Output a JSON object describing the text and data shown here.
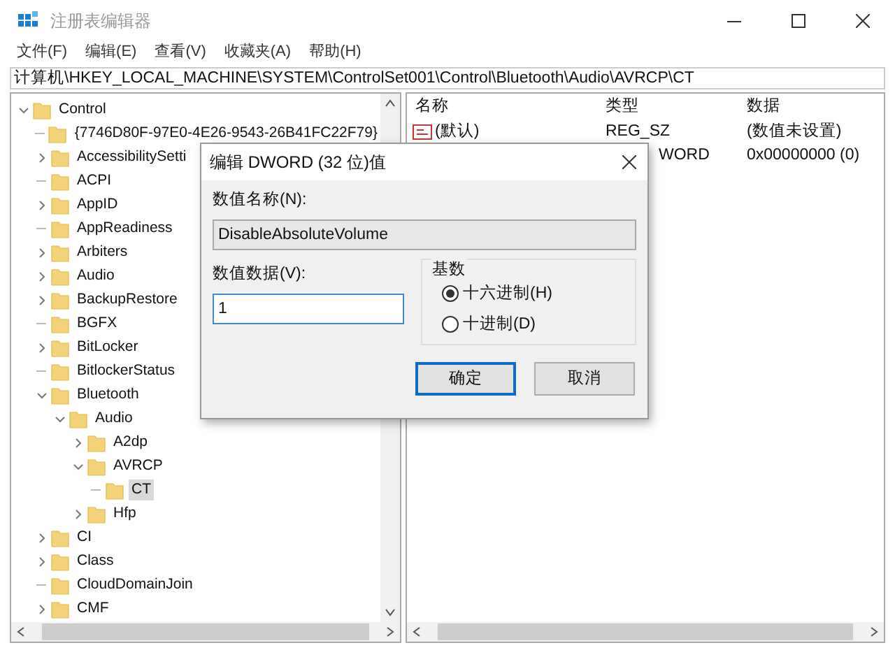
{
  "window": {
    "title": "注册表编辑器"
  },
  "menu": [
    "文件(F)",
    "编辑(E)",
    "查看(V)",
    "收藏夹(A)",
    "帮助(H)"
  ],
  "address": "计算机\\HKEY_LOCAL_MACHINE\\SYSTEM\\ControlSet001\\Control\\Bluetooth\\Audio\\AVRCP\\CT",
  "tree": [
    {
      "label": "Control",
      "expandable": true,
      "expanded": true,
      "selected": false,
      "children": [
        {
          "label": "{7746D80F-97E0-4E26-9543-26B41FC22F79}",
          "expandable": false,
          "selected": false
        },
        {
          "label": "AccessibilitySetti",
          "expandable": true,
          "expanded": false,
          "selected": false
        },
        {
          "label": "ACPI",
          "expandable": false,
          "selected": false
        },
        {
          "label": "AppID",
          "expandable": true,
          "expanded": false,
          "selected": false
        },
        {
          "label": "AppReadiness",
          "expandable": false,
          "selected": false
        },
        {
          "label": "Arbiters",
          "expandable": true,
          "expanded": false,
          "selected": false
        },
        {
          "label": "Audio",
          "expandable": true,
          "expanded": false,
          "selected": false
        },
        {
          "label": "BackupRestore",
          "expandable": true,
          "expanded": false,
          "selected": false
        },
        {
          "label": "BGFX",
          "expandable": false,
          "selected": false
        },
        {
          "label": "BitLocker",
          "expandable": true,
          "expanded": false,
          "selected": false
        },
        {
          "label": "BitlockerStatus",
          "expandable": false,
          "selected": false
        },
        {
          "label": "Bluetooth",
          "expandable": true,
          "expanded": true,
          "selected": false,
          "children": [
            {
              "label": "Audio",
              "expandable": true,
              "expanded": true,
              "selected": false,
              "children": [
                {
                  "label": "A2dp",
                  "expandable": true,
                  "expanded": false,
                  "selected": false
                },
                {
                  "label": "AVRCP",
                  "expandable": true,
                  "expanded": true,
                  "selected": false,
                  "children": [
                    {
                      "label": "CT",
                      "expandable": false,
                      "selected": true
                    }
                  ]
                },
                {
                  "label": "Hfp",
                  "expandable": true,
                  "expanded": false,
                  "selected": false
                }
              ]
            }
          ]
        },
        {
          "label": "CI",
          "expandable": true,
          "expanded": false,
          "selected": false
        },
        {
          "label": "Class",
          "expandable": true,
          "expanded": false,
          "selected": false
        },
        {
          "label": "CloudDomainJoin",
          "expandable": false,
          "selected": false
        },
        {
          "label": "CMF",
          "expandable": true,
          "expanded": false,
          "selected": false
        }
      ]
    }
  ],
  "values": {
    "columns": [
      "名称",
      "类型",
      "数据"
    ],
    "rows": [
      {
        "name": "(默认)",
        "type": "REG_SZ",
        "data": "(数值未设置)"
      },
      {
        "type": "WORD",
        "data": "0x00000000 (0)"
      }
    ]
  },
  "dialog": {
    "title": "编辑 DWORD (32 位)值",
    "name_label": "数值名称(N):",
    "name_value": "DisableAbsoluteVolume",
    "data_label": "数值数据(V):",
    "data_value": "1",
    "base_label": "基数",
    "bases": [
      {
        "label": "十六进制(H)",
        "selected": true
      },
      {
        "label": "十进制(D)",
        "selected": false
      }
    ],
    "buttons": [
      {
        "label": "确定",
        "default": true
      },
      {
        "label": "取消",
        "default": false
      }
    ]
  }
}
